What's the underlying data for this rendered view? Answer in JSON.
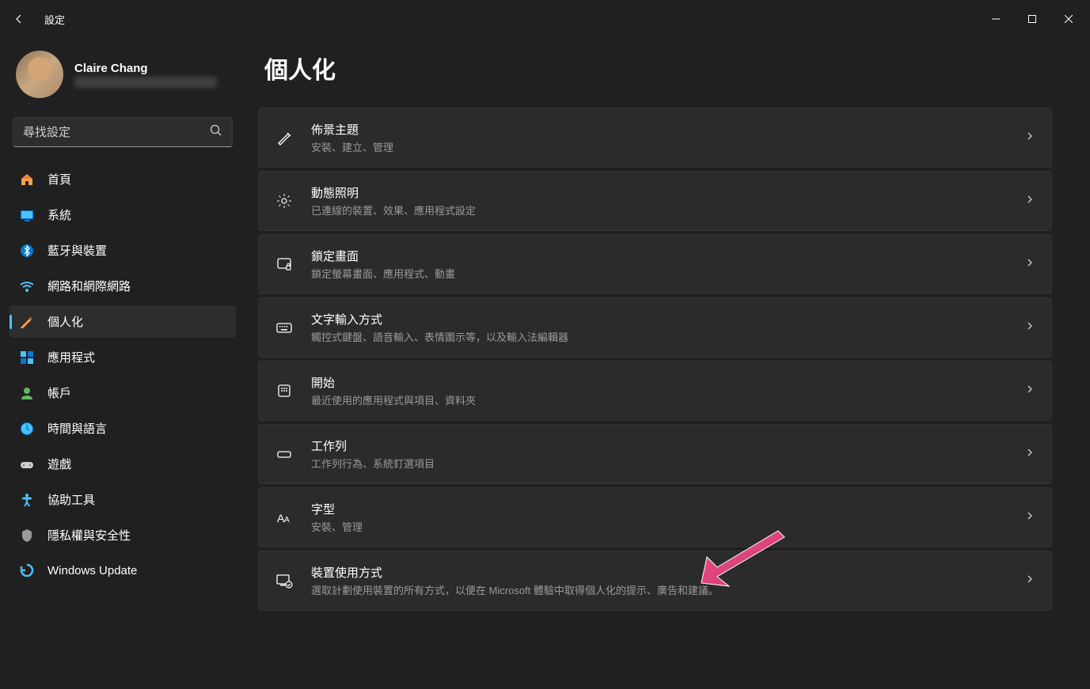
{
  "app": {
    "title": "設定"
  },
  "profile": {
    "name": "Claire Chang"
  },
  "search": {
    "placeholder": "尋找設定"
  },
  "nav": [
    {
      "label": "首頁",
      "icon": "home",
      "active": false
    },
    {
      "label": "系統",
      "icon": "system",
      "active": false
    },
    {
      "label": "藍牙與裝置",
      "icon": "bluetooth",
      "active": false
    },
    {
      "label": "網路和網際網路",
      "icon": "network",
      "active": false
    },
    {
      "label": "個人化",
      "icon": "personalize",
      "active": true
    },
    {
      "label": "應用程式",
      "icon": "apps",
      "active": false
    },
    {
      "label": "帳戶",
      "icon": "account",
      "active": false
    },
    {
      "label": "時間與語言",
      "icon": "time",
      "active": false
    },
    {
      "label": "遊戲",
      "icon": "gaming",
      "active": false
    },
    {
      "label": "協助工具",
      "icon": "accessibility",
      "active": false
    },
    {
      "label": "隱私權與安全性",
      "icon": "privacy",
      "active": false
    },
    {
      "label": "Windows Update",
      "icon": "update",
      "active": false
    }
  ],
  "page": {
    "title": "個人化"
  },
  "items": [
    {
      "title": "佈景主題",
      "desc": "安裝、建立、管理",
      "icon": "theme"
    },
    {
      "title": "動態照明",
      "desc": "已連線的裝置、效果、應用程式設定",
      "icon": "lighting"
    },
    {
      "title": "鎖定畫面",
      "desc": "鎖定螢幕畫面、應用程式、動畫",
      "icon": "lock"
    },
    {
      "title": "文字輸入方式",
      "desc": "觸控式鍵盤、語音輸入、表情圖示等，以及輸入法編輯器",
      "icon": "keyboard"
    },
    {
      "title": "開始",
      "desc": "最近使用的應用程式與項目、資料夾",
      "icon": "start"
    },
    {
      "title": "工作列",
      "desc": "工作列行為、系統釘選項目",
      "icon": "taskbar"
    },
    {
      "title": "字型",
      "desc": "安裝、管理",
      "icon": "font"
    },
    {
      "title": "裝置使用方式",
      "desc": "選取計劃使用裝置的所有方式，以便在 Microsoft 體驗中取得個人化的提示、廣告和建議。",
      "icon": "usage"
    }
  ]
}
